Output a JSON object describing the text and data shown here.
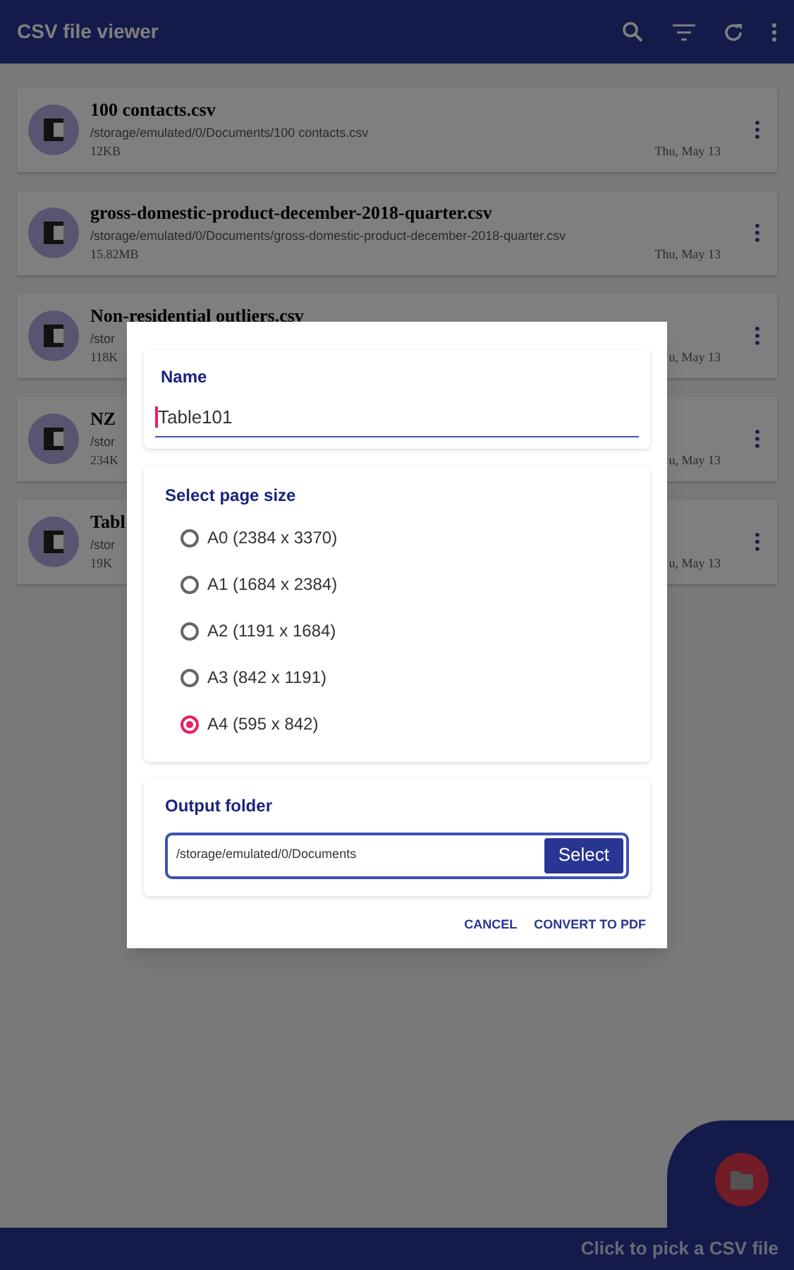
{
  "app_bar": {
    "title": "CSV file viewer"
  },
  "files": [
    {
      "name": "100 contacts.csv",
      "path": "/storage/emulated/0/Documents/100 contacts.csv",
      "size": "12KB",
      "date": "Thu, May 13"
    },
    {
      "name": "gross-domestic-product-december-2018-quarter.csv",
      "path": "/storage/emulated/0/Documents/gross-domestic-product-december-2018-quarter.csv",
      "size": "15.82MB",
      "date": "Thu, May 13"
    },
    {
      "name": "Non-residential outliers.csv",
      "path": "/stor",
      "size": "118K",
      "date": "u, May 13"
    },
    {
      "name": "NZ",
      "path": "/stor",
      "size": "234K",
      "date": "u, May 13"
    },
    {
      "name": "Tabl",
      "path": "/stor",
      "size": "19K",
      "date": "u, May 13"
    }
  ],
  "dialog": {
    "name_label": "Name",
    "name_value": "Table101",
    "page_size_label": "Select page size",
    "page_sizes": [
      {
        "label": "A0 (2384 x 3370)",
        "selected": false
      },
      {
        "label": "A1 (1684 x 2384)",
        "selected": false
      },
      {
        "label": "A2 (1191 x 1684)",
        "selected": false
      },
      {
        "label": "A3 (842 x 1191)",
        "selected": false
      },
      {
        "label": "A4 (595 x 842)",
        "selected": true
      }
    ],
    "output_label": "Output folder",
    "output_path": "/storage/emulated/0/Documents",
    "select_button": "Select",
    "buttons": [
      "CANCEL",
      "CONVERT TO PDF"
    ]
  },
  "bottom_bar": {
    "text": "Click to pick a CSV file"
  }
}
